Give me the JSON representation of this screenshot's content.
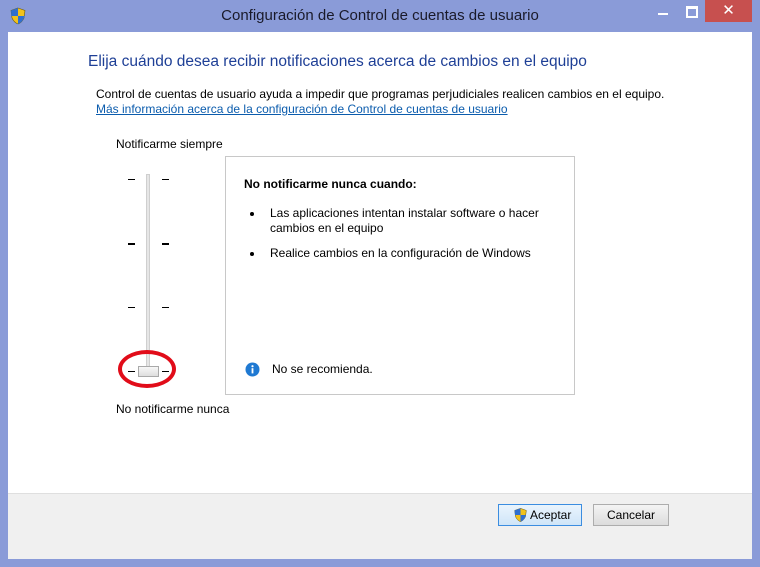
{
  "window": {
    "title": "Configuración de Control de cuentas de usuario",
    "close_symbol": "✕"
  },
  "main": {
    "heading": "Elija cuándo desea recibir notificaciones acerca de cambios en el equipo",
    "description": "Control de cuentas de usuario ayuda a impedir que programas perjudiciales realicen cambios en el equipo.",
    "link": "Más información acerca de la configuración de Control de cuentas de usuario"
  },
  "slider": {
    "top_label": "Notificarme siempre",
    "bottom_label": "No notificarme nunca",
    "levels": 4,
    "selected_level": 1
  },
  "panel": {
    "title": "No notificarme nunca cuando:",
    "bullets": [
      "Las aplicaciones intentan instalar software o hacer cambios en el equipo",
      "Realice cambios en la configuración de Windows"
    ],
    "note": "No se recomienda."
  },
  "footer": {
    "ok_label": "Aceptar",
    "cancel_label": "Cancelar"
  },
  "colors": {
    "frame": "#8a9bd8",
    "heading": "#1e3f96",
    "link": "#0b5cad",
    "close": "#c7504f",
    "highlight": "#e10c19"
  },
  "icons": {
    "title_icon": "uac-shield-icon",
    "info_icon": "info-icon",
    "ok_icon": "uac-shield-icon"
  }
}
